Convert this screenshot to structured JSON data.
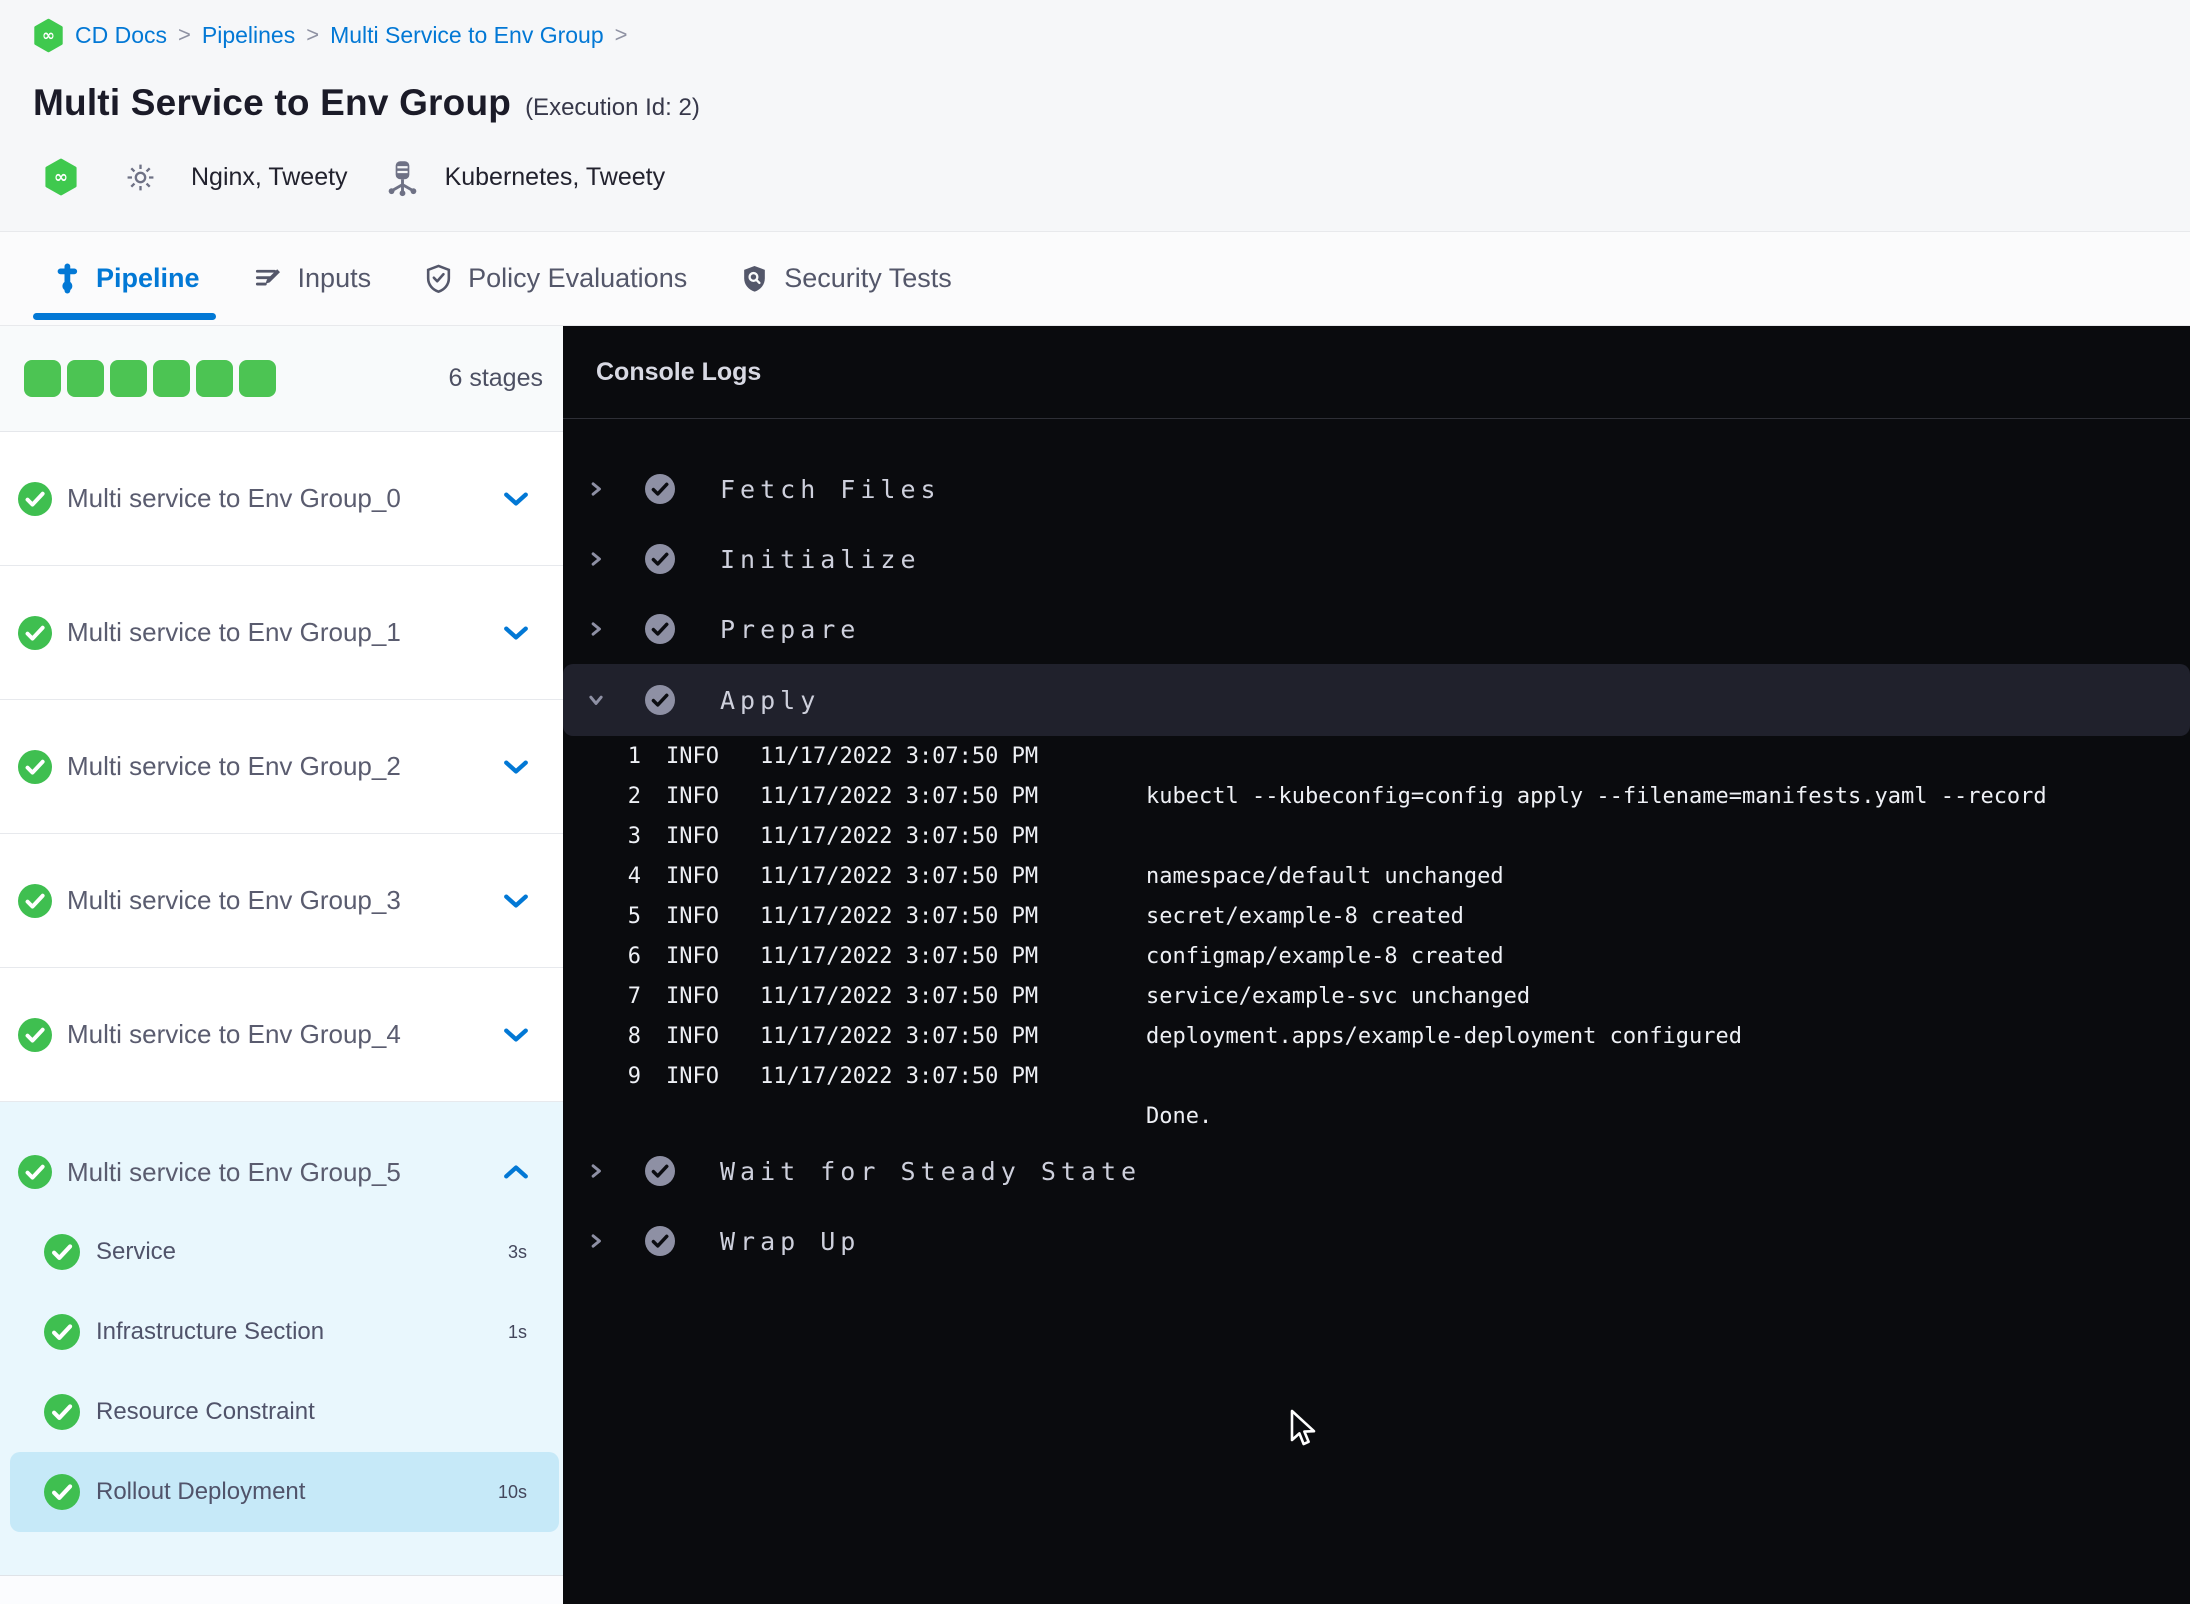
{
  "breadcrumb": {
    "separator": ">",
    "items": [
      "CD Docs",
      "Pipelines",
      "Multi Service to Env Group"
    ]
  },
  "header": {
    "title": "Multi Service to Env Group",
    "execution_id": "(Execution Id: 2)",
    "services_label": "Nginx, Tweety",
    "environments_label": "Kubernetes, Tweety"
  },
  "tabs": [
    {
      "label": "Pipeline",
      "active": true
    },
    {
      "label": "Inputs",
      "active": false
    },
    {
      "label": "Policy Evaluations",
      "active": false
    },
    {
      "label": "Security Tests",
      "active": false
    }
  ],
  "sidebar": {
    "stage_count_label": "6 stages",
    "stage_squares": 6,
    "stages": [
      {
        "label": "Multi service to Env Group_0",
        "status": "success",
        "expanded": false
      },
      {
        "label": "Multi service to Env Group_1",
        "status": "success",
        "expanded": false
      },
      {
        "label": "Multi service to Env Group_2",
        "status": "success",
        "expanded": false
      },
      {
        "label": "Multi service to Env Group_3",
        "status": "success",
        "expanded": false
      },
      {
        "label": "Multi service to Env Group_4",
        "status": "success",
        "expanded": false
      },
      {
        "label": "Multi service to Env Group_5",
        "status": "success",
        "expanded": true
      }
    ],
    "substeps": [
      {
        "label": "Service",
        "duration": "3s",
        "selected": false
      },
      {
        "label": "Infrastructure Section",
        "duration": "1s",
        "selected": false
      },
      {
        "label": "Resource Constraint",
        "duration": "",
        "selected": false
      },
      {
        "label": "Rollout Deployment",
        "duration": "10s",
        "selected": true
      }
    ]
  },
  "console": {
    "title": "Console Logs",
    "steps": [
      {
        "label": "Fetch Files",
        "expanded": false
      },
      {
        "label": "Initialize",
        "expanded": false
      },
      {
        "label": "Prepare",
        "expanded": false
      },
      {
        "label": "Apply",
        "expanded": true
      },
      {
        "label": "Wait for Steady State",
        "expanded": false
      },
      {
        "label": "Wrap Up",
        "expanded": false
      }
    ],
    "logs": [
      {
        "num": "1",
        "level": "INFO",
        "time": "11/17/2022 3:07:50 PM",
        "message": ""
      },
      {
        "num": "2",
        "level": "INFO",
        "time": "11/17/2022 3:07:50 PM",
        "message": "kubectl --kubeconfig=config apply --filename=manifests.yaml --record"
      },
      {
        "num": "3",
        "level": "INFO",
        "time": "11/17/2022 3:07:50 PM",
        "message": ""
      },
      {
        "num": "4",
        "level": "INFO",
        "time": "11/17/2022 3:07:50 PM",
        "message": "namespace/default unchanged"
      },
      {
        "num": "5",
        "level": "INFO",
        "time": "11/17/2022 3:07:50 PM",
        "message": "secret/example-8 created"
      },
      {
        "num": "6",
        "level": "INFO",
        "time": "11/17/2022 3:07:50 PM",
        "message": "configmap/example-8 created"
      },
      {
        "num": "7",
        "level": "INFO",
        "time": "11/17/2022 3:07:50 PM",
        "message": "service/example-svc unchanged"
      },
      {
        "num": "8",
        "level": "INFO",
        "time": "11/17/2022 3:07:50 PM",
        "message": "deployment.apps/example-deployment configured"
      },
      {
        "num": "9",
        "level": "INFO",
        "time": "11/17/2022 3:07:50 PM",
        "message": ""
      },
      {
        "num": "",
        "level": "",
        "time": "",
        "message": "Done."
      }
    ]
  },
  "colors": {
    "accent_blue": "#0278d5",
    "success_green": "#4cc453",
    "console_bg": "#0a0b0e",
    "apply_row_bg": "#20212c",
    "expanded_card_blue": "#e9f7fd",
    "selected_row_blue": "#c6e9f8"
  }
}
